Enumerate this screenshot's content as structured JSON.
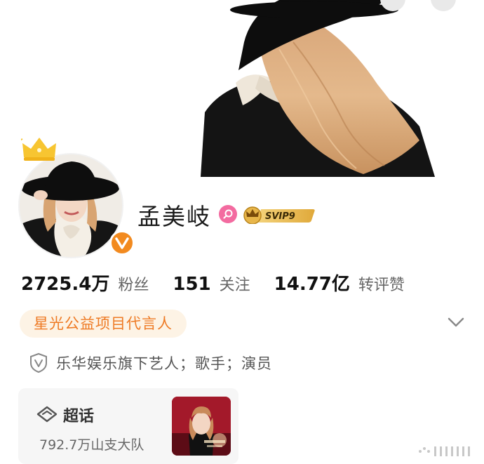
{
  "profile": {
    "name": "孟美岐",
    "vip_level": "SVIP9"
  },
  "stats": {
    "followers_count": "2725.4万",
    "followers_label": "粉丝",
    "following_count": "151",
    "following_label": "关注",
    "likes_count": "14.77亿",
    "likes_label": "转评赞"
  },
  "tag": {
    "label": "星光公益项目代言人"
  },
  "org": {
    "text": "乐华娱乐旗下艺人；歌手；演员"
  },
  "supertopic": {
    "title": "超话",
    "subtitle": "792.7万山支大队"
  },
  "icons": {
    "crown": "crown-icon",
    "verified": "verified-v-icon",
    "search": "search-icon",
    "vip": "svip-badge-icon",
    "expand": "chevron-down-icon",
    "shield": "shield-v-icon",
    "supertopic": "supertopic-diamond-icon"
  },
  "colors": {
    "accent_orange": "#f28a1f",
    "tag_text": "#ee7a24",
    "tag_bg": "#fdf3e5",
    "search_badge": "#f36ba0",
    "vip_gold": "#e8b64a",
    "crown_yellow": "#f7c531"
  }
}
